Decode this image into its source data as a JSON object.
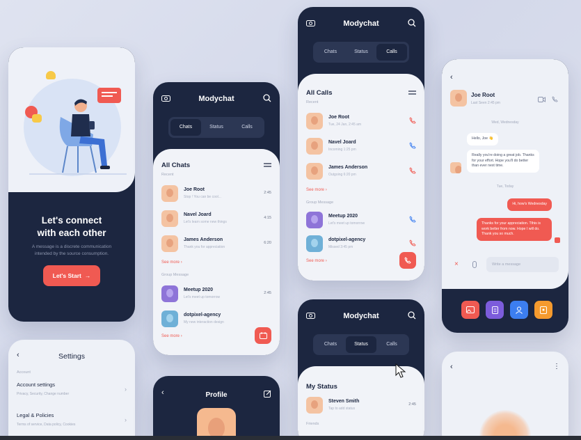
{
  "onboard": {
    "title_line1": "Let's connect",
    "title_line2": "with each other",
    "subtitle": "A message is a discrete communication intended by the source consumption.",
    "button_label": "Let's Start"
  },
  "app_name": "Modychat",
  "tabs": [
    "Chats",
    "Status",
    "Calls"
  ],
  "chats_screen": {
    "section_title": "All Chats",
    "recent_label": "Recent",
    "rows": [
      {
        "name": "Joe Root",
        "msg": "Stop ! You can be cool...",
        "time": "2:45"
      },
      {
        "name": "Navel Joard",
        "msg": "Let's learn some new things",
        "time": "4:15"
      },
      {
        "name": "James Anderson",
        "msg": "Thank you for appreciation",
        "time": "6:20"
      }
    ],
    "see_more": "See more",
    "group_label": "Group Message",
    "groups": [
      {
        "name": "Meetup 2020",
        "msg": "Let's meet up tomorrow",
        "time": "2:45"
      },
      {
        "name": "dotpixel-agency",
        "msg": "My new interaction design",
        "time": ""
      }
    ],
    "see_more2": "See more"
  },
  "calls_screen": {
    "section_title": "All Calls",
    "recent_label": "Recent",
    "rows": [
      {
        "name": "Joe Root",
        "msg": "Tue, 24 Jan, 2:45 am"
      },
      {
        "name": "Navel Joard",
        "msg": "Incoming 1:25 pm"
      },
      {
        "name": "James Anderson",
        "msg": "Outgoing 6:20 pm"
      }
    ],
    "see_more": "See more",
    "group_label": "Group Message",
    "groups": [
      {
        "name": "Meetup 2020",
        "msg": "Let's meet up tomorrow"
      },
      {
        "name": "dotpixel-agency",
        "msg": "Missed 3:45 pm"
      }
    ],
    "see_more2": "See more"
  },
  "status_screen": {
    "section_title": "My Status",
    "row": {
      "name": "Steven Smith",
      "msg": "Tap to add status",
      "time": "2:45"
    },
    "friends_label": "Friends"
  },
  "convo": {
    "name": "Joe Root",
    "last_seen": "Last Seen 2:45 pm",
    "day1": "Wed, Wednesday",
    "msg1": "Hello, Joe 👋",
    "msg2": "Really you're doing a great job. Thanks for your effort. Hope you'll do better than ever next time.",
    "day2": "Tue, Today",
    "msg3": "Hi, how's Wednesday",
    "msg4": "Thanks for your appreciation. Tthis is work better from now. Hope I will do. Thank you so much.",
    "input_placeholder": "Write a message",
    "tile_colors": [
      "#f05a52",
      "#7c5cdb",
      "#3c7ef0",
      "#f59a2e"
    ]
  },
  "settings": {
    "title": "Settings",
    "section": "Account",
    "item1": "Account settings",
    "item1_sub": "Privacy, Security, Change number",
    "item2": "Legal & Policies",
    "item2_sub": "Terms of service, Data policy, Cookies"
  },
  "profile": {
    "title": "Profile"
  },
  "colors": {
    "navy": "#1c2640",
    "accent": "#f05a52"
  }
}
